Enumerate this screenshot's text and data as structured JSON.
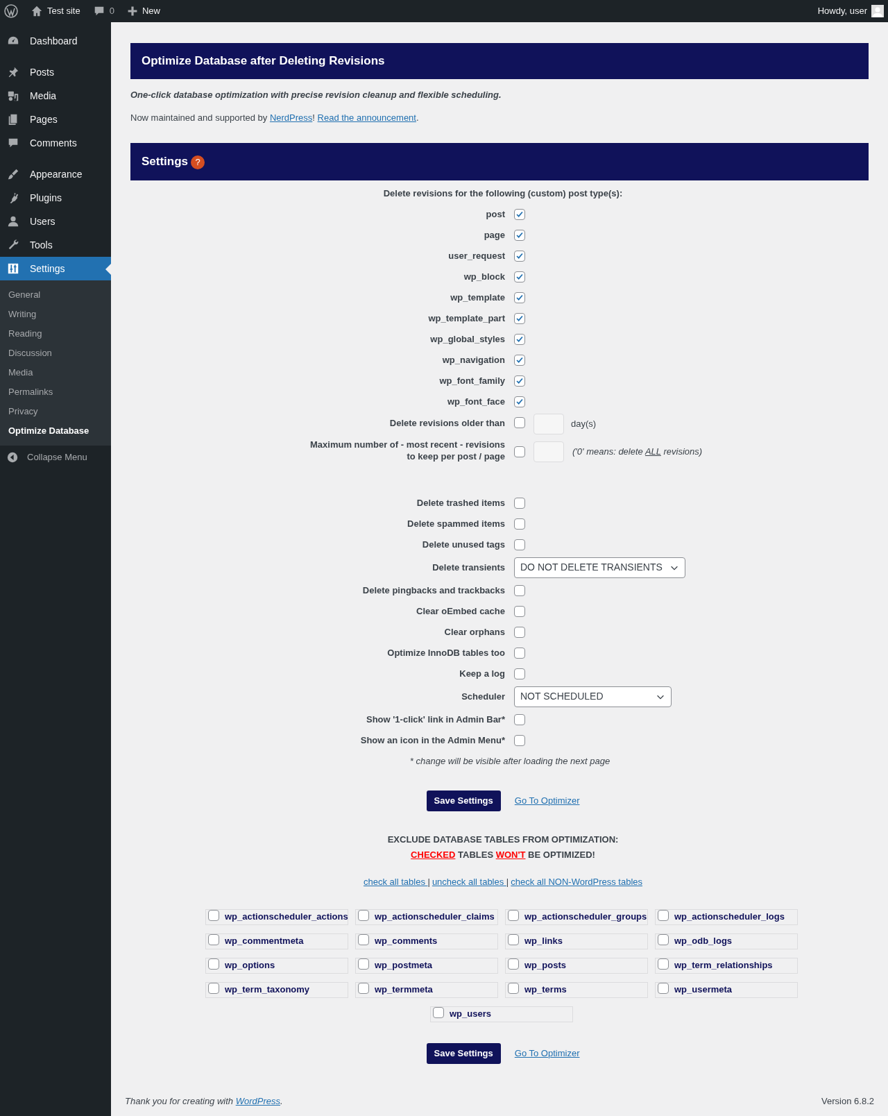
{
  "admin_bar": {
    "site": "Test site",
    "comments": "0",
    "new": "New",
    "greeting": "Howdy, user"
  },
  "sidebar": {
    "items": [
      {
        "label": "Dashboard",
        "selected": false
      },
      {
        "label": "Posts",
        "selected": false
      },
      {
        "label": "Media",
        "selected": false
      },
      {
        "label": "Pages",
        "selected": false
      },
      {
        "label": "Comments",
        "selected": false
      },
      {
        "label": "Appearance",
        "selected": false
      },
      {
        "label": "Plugins",
        "selected": false
      },
      {
        "label": "Users",
        "selected": false
      },
      {
        "label": "Tools",
        "selected": false
      },
      {
        "label": "Settings",
        "selected": true
      }
    ],
    "submenu": [
      {
        "label": "General",
        "selected": false
      },
      {
        "label": "Writing",
        "selected": false
      },
      {
        "label": "Reading",
        "selected": false
      },
      {
        "label": "Discussion",
        "selected": false
      },
      {
        "label": "Media",
        "selected": false
      },
      {
        "label": "Permalinks",
        "selected": false
      },
      {
        "label": "Privacy",
        "selected": false
      },
      {
        "label": "Optimize Database",
        "selected": true
      }
    ],
    "collapse": "Collapse Menu"
  },
  "header": {
    "title": "Optimize Database after Deleting Revisions",
    "tagline": "One-click database optimization with precise revision cleanup and flexible scheduling.",
    "notice": [
      {
        "kind": "text",
        "text": "Now maintained and supported by "
      },
      {
        "kind": "link",
        "text": "NerdPress"
      },
      {
        "kind": "text",
        "text": "! "
      },
      {
        "kind": "link",
        "text": "Read the announcement"
      },
      {
        "kind": "text",
        "text": "."
      }
    ]
  },
  "settings": {
    "title": "Settings",
    "help": "?",
    "post_types_heading": "Delete revisions for the following (custom) post type(s):",
    "post_types": [
      {
        "label": "post",
        "checked": true
      },
      {
        "label": "page",
        "checked": true
      },
      {
        "label": "user_request",
        "checked": true
      },
      {
        "label": "wp_block",
        "checked": true
      },
      {
        "label": "wp_template",
        "checked": true
      },
      {
        "label": "wp_template_part",
        "checked": true
      },
      {
        "label": "wp_global_styles",
        "checked": true
      },
      {
        "label": "wp_navigation",
        "checked": true
      },
      {
        "label": "wp_font_family",
        "checked": true
      },
      {
        "label": "wp_font_face",
        "checked": true
      }
    ],
    "options": [
      {
        "kind": "checkbox_input",
        "label": "Delete revisions older than",
        "checked": false,
        "after": [
          {
            "kind": "plain",
            "text": "day(s)"
          }
        ]
      },
      {
        "kind": "checkbox_input",
        "label": "Maximum number of - most recent - revisions\nto keep per post / page",
        "checked": false,
        "after": [
          {
            "kind": "plain",
            "text": "('0' means: delete "
          },
          {
            "kind": "underlined",
            "text": "ALL"
          },
          {
            "kind": "plain",
            "text": " revisions)"
          }
        ]
      },
      {
        "kind": "spacer"
      },
      {
        "kind": "checkbox",
        "label": "Delete trashed items",
        "checked": false
      },
      {
        "kind": "checkbox",
        "label": "Delete spammed items",
        "checked": false
      },
      {
        "kind": "checkbox",
        "label": "Delete unused tags",
        "checked": false
      },
      {
        "kind": "select",
        "label": "Delete transients",
        "value": "DO NOT DELETE TRANSIENTS"
      },
      {
        "kind": "checkbox",
        "label": "Delete pingbacks and trackbacks",
        "checked": false
      },
      {
        "kind": "checkbox",
        "label": "Clear oEmbed cache",
        "checked": false
      },
      {
        "kind": "checkbox",
        "label": "Clear orphans",
        "checked": false
      },
      {
        "kind": "checkbox",
        "label": "Optimize InnoDB tables too",
        "checked": false
      },
      {
        "kind": "checkbox",
        "label": "Keep a log",
        "checked": false
      },
      {
        "kind": "select",
        "label": "Scheduler",
        "value": "NOT SCHEDULED"
      },
      {
        "kind": "checkbox",
        "label": "Show '1-click' link in Admin Bar*",
        "checked": false
      },
      {
        "kind": "checkbox",
        "label": "Show an icon in the Admin Menu*",
        "checked": false
      }
    ],
    "note": "* change will be visible after loading the next page"
  },
  "actions_top": {
    "save": "Save Settings",
    "optimizer": "Go To Optimizer"
  },
  "exclude": {
    "heading": "EXCLUDE DATABASE TABLES FROM OPTIMIZATION:",
    "warning": [
      {
        "kind": "alert",
        "text": "CHECKED"
      },
      {
        "kind": "plain",
        "text": " TABLES "
      },
      {
        "kind": "alert",
        "text": "WON'T"
      },
      {
        "kind": "plain",
        "text": " BE OPTIMIZED!"
      }
    ],
    "links": [
      {
        "kind": "link",
        "text": "check all tables "
      },
      {
        "kind": "sep",
        "text": "|"
      },
      {
        "kind": "link",
        "text": "uncheck all tables "
      },
      {
        "kind": "sep",
        "text": "|"
      },
      {
        "kind": "link",
        "text": "check all NON-WordPress tables"
      }
    ],
    "tables": [
      {
        "name": "wp_actionscheduler_actions",
        "checked": false
      },
      {
        "name": "wp_actionscheduler_claims",
        "checked": false
      },
      {
        "name": "wp_actionscheduler_groups",
        "checked": false
      },
      {
        "name": "wp_actionscheduler_logs",
        "checked": false
      },
      {
        "name": "wp_commentmeta",
        "checked": false
      },
      {
        "name": "wp_comments",
        "checked": false
      },
      {
        "name": "wp_links",
        "checked": false
      },
      {
        "name": "wp_odb_logs",
        "checked": false
      },
      {
        "name": "wp_options",
        "checked": false
      },
      {
        "name": "wp_postmeta",
        "checked": false
      },
      {
        "name": "wp_posts",
        "checked": false
      },
      {
        "name": "wp_term_relationships",
        "checked": false
      },
      {
        "name": "wp_term_taxonomy",
        "checked": false
      },
      {
        "name": "wp_termmeta",
        "checked": false
      },
      {
        "name": "wp_terms",
        "checked": false
      },
      {
        "name": "wp_usermeta",
        "checked": false
      },
      {
        "name": "wp_users",
        "checked": false
      }
    ]
  },
  "actions_bottom": {
    "save": "Save Settings",
    "optimizer": "Go To Optimizer"
  },
  "footer": {
    "thanks": [
      {
        "kind": "text",
        "text": "Thank you for creating with "
      },
      {
        "kind": "link",
        "text": "WordPress"
      },
      {
        "kind": "text",
        "text": "."
      }
    ],
    "version": "Version 6.8.2"
  }
}
